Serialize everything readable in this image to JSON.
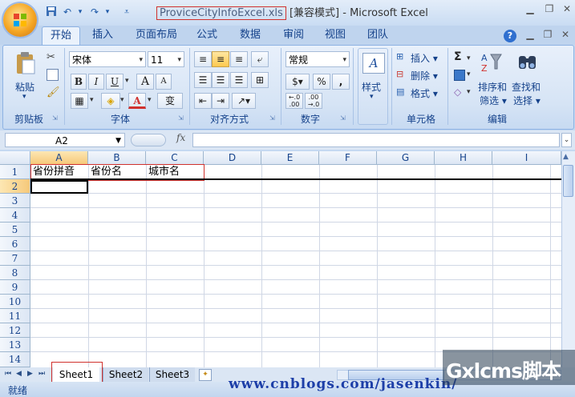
{
  "window": {
    "filename": "ProviceCityInfoExcel.xls",
    "mode": "[兼容模式]",
    "app": "Microsoft Excel",
    "separator": "-"
  },
  "tabs": [
    "开始",
    "插入",
    "页面布局",
    "公式",
    "数据",
    "审阅",
    "视图",
    "团队"
  ],
  "ribbon": {
    "clipboard": {
      "paste": "粘贴",
      "label": "剪贴板"
    },
    "font": {
      "name": "宋体",
      "size": "11",
      "bold": "B",
      "italic": "I",
      "underline": "U",
      "grow": "A",
      "shrink": "A",
      "font_color_glyph": "A",
      "phonetic": "变",
      "label": "字体"
    },
    "alignment": {
      "label": "对齐方式"
    },
    "number": {
      "format": "常规",
      "percent": "%",
      "comma": ",",
      "inc_decimal": "←.0\n.00",
      "dec_decimal": ".00\n→.0",
      "label": "数字"
    },
    "styles": {
      "style": "样式",
      "style_glyph": "A"
    },
    "cells": {
      "insert": "插入",
      "delete": "删除",
      "format": "格式",
      "label": "单元格"
    },
    "editing": {
      "sum": "Σ",
      "sort": "排序和",
      "sort2": "筛选",
      "find": "查找和",
      "find2": "选择",
      "label": "编辑"
    }
  },
  "formula_bar": {
    "namebox": "A2",
    "fx": "fx",
    "value": ""
  },
  "columns": [
    "A",
    "B",
    "C",
    "D",
    "E",
    "F",
    "G",
    "H",
    "I"
  ],
  "rows": [
    "1",
    "2",
    "3",
    "4",
    "5",
    "6",
    "7",
    "8",
    "9",
    "10",
    "11",
    "12",
    "13",
    "14"
  ],
  "cells": {
    "A1": "省份拼音",
    "B1": "省份名",
    "C1": "城市名"
  },
  "sheets": [
    "Sheet1",
    "Sheet2",
    "Sheet3"
  ],
  "status": {
    "ready": "就绪"
  },
  "watermark": {
    "url": "www.cnblogs.com/jasenkin/",
    "brand": "Gxlcms脚本"
  }
}
